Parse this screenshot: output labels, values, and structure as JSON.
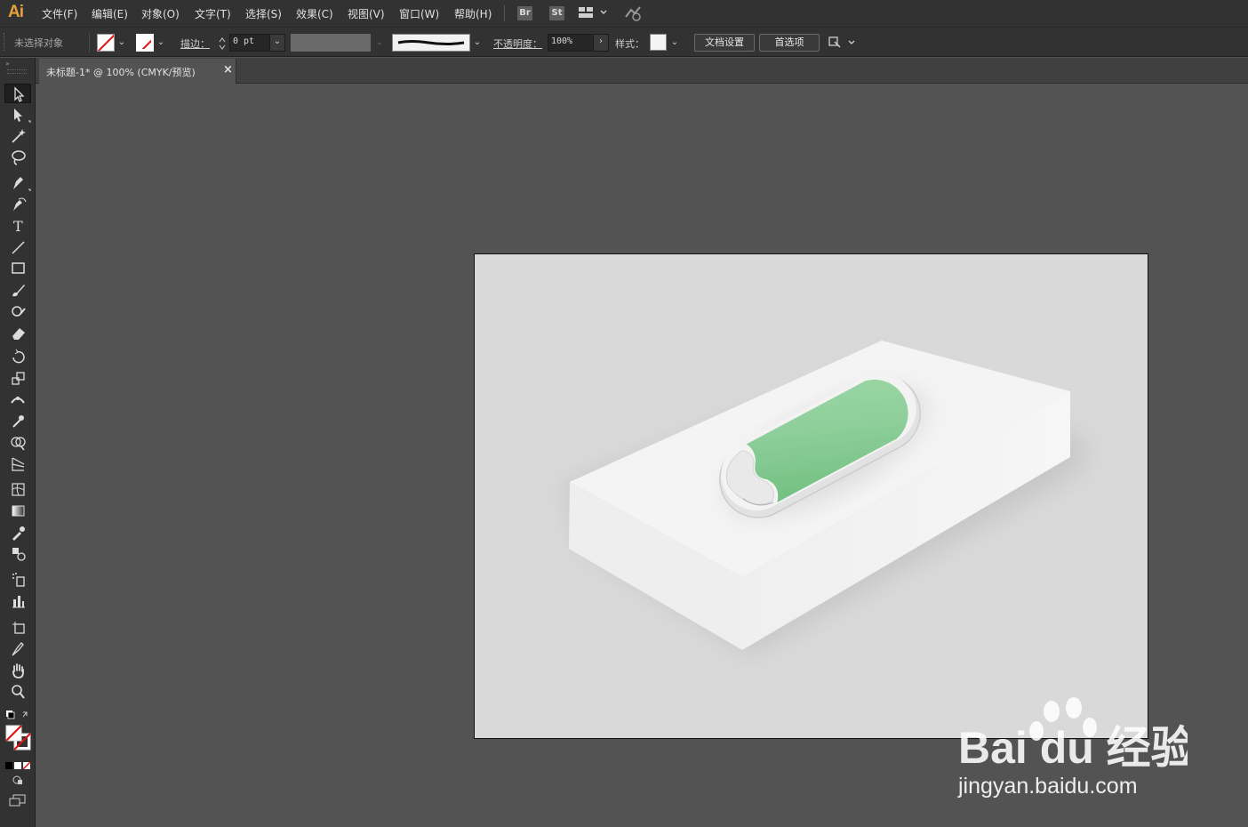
{
  "app": {
    "logo_text": "Ai"
  },
  "menu": [
    "文件(F)",
    "编辑(E)",
    "对象(O)",
    "文字(T)",
    "选择(S)",
    "效果(C)",
    "视图(V)",
    "窗口(W)",
    "帮助(H)"
  ],
  "menu_icons": {
    "bridge": "Br",
    "stock": "St",
    "arrange": "layout-icon",
    "sync": "sync-icon"
  },
  "control_bar": {
    "selection_status": "未选择对象",
    "stroke_label": "描边：",
    "stroke_value": "0 pt",
    "opacity_label": "不透明度：",
    "opacity_value": "100%",
    "style_label": "样式：",
    "doc_setup_button": "文档设置",
    "preferences_button": "首选项"
  },
  "document_tab": {
    "title": "未标题-1* @ 100% (CMYK/预览)",
    "close_glyph": "×"
  },
  "tools": [
    "selection-tool",
    "direct-selection-tool",
    "magic-wand-tool",
    "lasso-tool",
    "pen-tool",
    "curvature-tool",
    "type-tool",
    "line-segment-tool",
    "rectangle-tool",
    "paintbrush-tool",
    "shaper-tool",
    "eraser-tool",
    "rotate-tool",
    "scale-tool",
    "width-tool",
    "puppet-warp-tool",
    "shape-builder-tool",
    "perspective-grid-tool",
    "mesh-tool",
    "gradient-tool",
    "eyedropper-tool",
    "blend-tool",
    "symbol-sprayer-tool",
    "column-graph-tool",
    "artboard-tool",
    "slice-tool",
    "hand-tool",
    "zoom-tool"
  ],
  "colors": {
    "ui_dark": "#323232",
    "canvas": "#535353",
    "artboard": "#d9d9d9",
    "box_top": "#f4f4f4",
    "device_green": "#8ccc98",
    "none_stroke_red": "#e01010",
    "logo_orange": "#e8a03c"
  },
  "watermark": {
    "brand": "Bai du 经验",
    "url": "jingyan.baidu.com"
  }
}
